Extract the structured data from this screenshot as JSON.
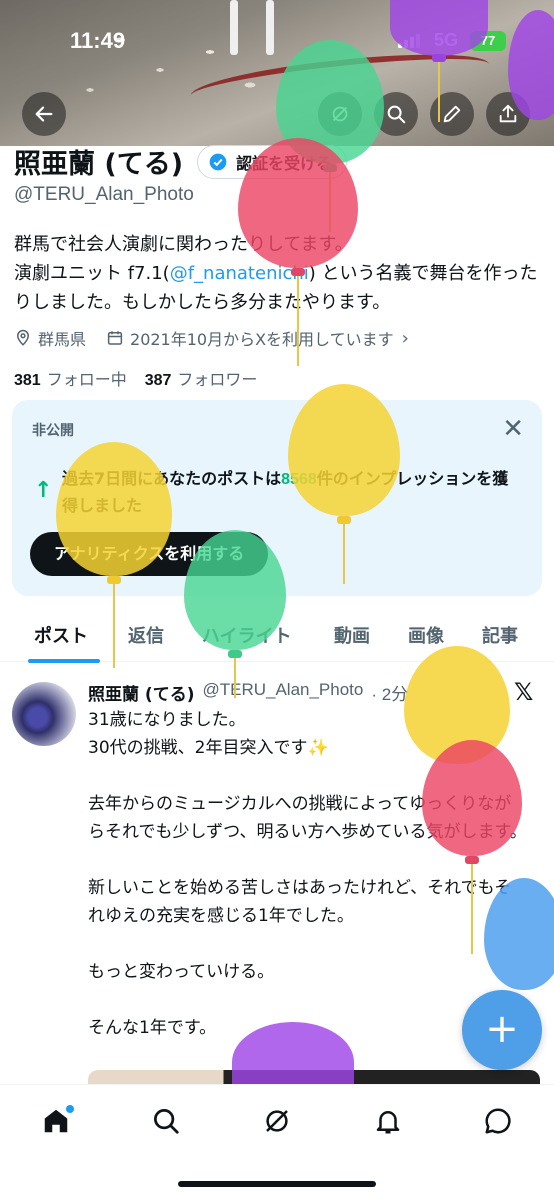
{
  "status_bar": {
    "time": "11:49",
    "network": "5G",
    "battery": "77"
  },
  "header_buttons": [
    "back",
    "grok",
    "search",
    "edit",
    "share"
  ],
  "profile": {
    "name": "照亜蘭 (てる)",
    "verify_label": "認証を受ける",
    "handle": "@TERU_Alan_Photo",
    "bio_line1": "群馬で社会人演劇に関わったりしてます。",
    "bio_line2_pre": "演劇ユニット f7.1(",
    "bio_link": "@f_nanatenichi",
    "bio_line2_post": ") という名義で舞台を作ったりしました。もしかしたら多分またやります。",
    "location": "群馬県",
    "joined": "2021年10月からXを利用しています",
    "following_count": "381",
    "following_label": "フォロー中",
    "followers_count": "387",
    "followers_label": "フォロワー"
  },
  "private_card": {
    "label": "非公開",
    "message_pre": "過去7日間にあなたのポストは",
    "message_num": "8568",
    "message_post": "件のインプレッションを獲得しました",
    "button_label": "アナリティクスを利用する"
  },
  "tabs": [
    {
      "label": "ポスト",
      "active": true
    },
    {
      "label": "返信",
      "active": false
    },
    {
      "label": "ハイライト",
      "active": false
    },
    {
      "label": "動画",
      "active": false
    },
    {
      "label": "画像",
      "active": false
    },
    {
      "label": "記事",
      "active": false
    }
  ],
  "post": {
    "author": "照亜蘭 (てる)",
    "handle": "@TERU_Alan_Photo",
    "time": "· 2分",
    "line1": "31歳になりました。",
    "line2": "30代の挑戦、2年目突入です",
    "para2": "去年からのミュージカルへの挑戦によってゆっくりながらそれでも少しずつ、明るい方へ歩めている気がします。",
    "para3": "新しいことを始める苦しさはあったけれど、それでもそれゆえの充実を感じる1年でした。",
    "para4": "もっと変わっていける。",
    "para5": "そんな1年です。"
  },
  "fab": {
    "label": "+"
  },
  "bottom_nav": [
    "home",
    "search",
    "grok",
    "notifications",
    "messages"
  ],
  "colors": {
    "accent": "#1d9bf0",
    "green": "#00ba7c",
    "card_bg": "#e8f5fd",
    "fab": "#4f9ee8"
  },
  "balloons": [
    "green",
    "red",
    "yellow",
    "yellow",
    "green",
    "yellow",
    "red",
    "blue",
    "purple",
    "purple"
  ]
}
